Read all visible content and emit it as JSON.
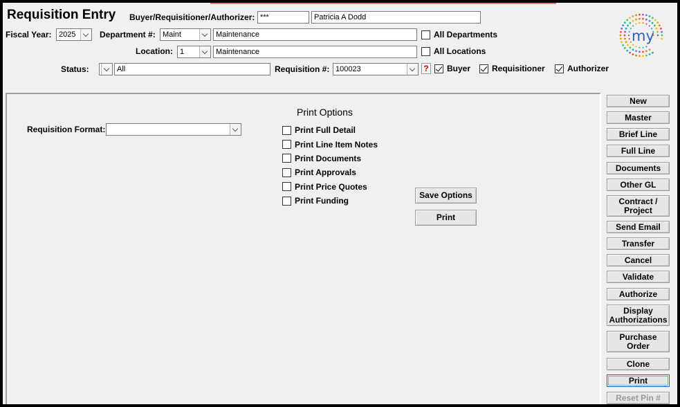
{
  "header": {
    "title": "Requisition Entry",
    "buyer_label": "Buyer/Requisitioner/Authorizer:",
    "buyer_code": "***",
    "buyer_name": "Patricia A  Dodd"
  },
  "fiscal": {
    "label": "Fiscal Year:",
    "value": "2025"
  },
  "department": {
    "label": "Department #:",
    "code": "Maint",
    "name": "Maintenance",
    "all_label": "All Departments",
    "all_checked": false
  },
  "location": {
    "label": "Location:",
    "code": "1",
    "name": "Maintenance",
    "all_label": "All Locations",
    "all_checked": false
  },
  "status": {
    "label": "Status:",
    "code": "",
    "value": "All"
  },
  "requisition": {
    "label": "Requisition #:",
    "value": "100023",
    "help": "?"
  },
  "roles": [
    {
      "label": "Buyer",
      "checked": true
    },
    {
      "label": "Requisitioner",
      "checked": true
    },
    {
      "label": "Authorizer",
      "checked": true
    }
  ],
  "logo": {
    "text": "my"
  },
  "print": {
    "format_label": "Requisition Format:",
    "format_value": "",
    "options_title": "Print Options",
    "options": [
      {
        "label": "Print Full Detail",
        "checked": false
      },
      {
        "label": "Print Line Item Notes",
        "checked": false
      },
      {
        "label": "Print Documents",
        "checked": false
      },
      {
        "label": "Print Approvals",
        "checked": false
      },
      {
        "label": "Print Price Quotes",
        "checked": false
      },
      {
        "label": "Print Funding",
        "checked": false
      }
    ],
    "save_label": "Save Options",
    "print_label": "Print"
  },
  "sidebar": [
    {
      "label": "New"
    },
    {
      "label": "Master"
    },
    {
      "label": "Brief Line"
    },
    {
      "label": "Full Line"
    },
    {
      "label": "Documents"
    },
    {
      "label": "Other GL"
    },
    {
      "label": "Contract /\nProject"
    },
    {
      "label": "Send Email"
    },
    {
      "label": "Transfer"
    },
    {
      "label": "Cancel"
    },
    {
      "label": "Validate"
    },
    {
      "label": "Authorize"
    },
    {
      "label": "Display\nAuthorizations"
    },
    {
      "label": "Purchase\nOrder"
    },
    {
      "label": "Clone"
    },
    {
      "label": "Print"
    },
    {
      "label": "Reset Pin #"
    }
  ],
  "colors": {
    "accent": "#1a5bc4",
    "help": "#d40000",
    "logo_text": "#2b63b8"
  }
}
